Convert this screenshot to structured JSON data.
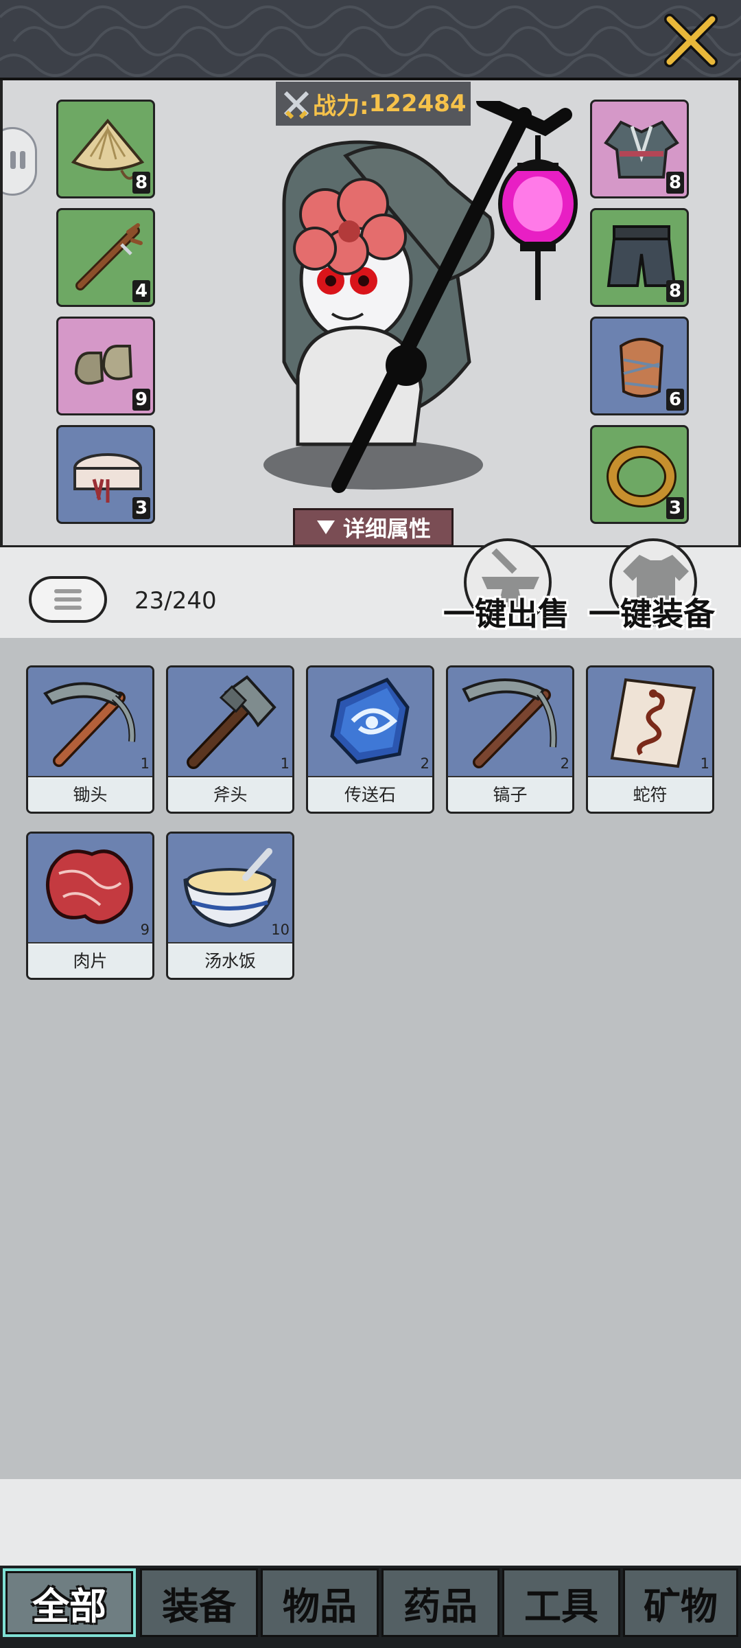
{
  "header": {
    "close_icon": "crossed-swords-close-icon"
  },
  "character": {
    "power_label": "战力:",
    "power_value": "122484",
    "detail_button": "详细属性",
    "left_slots": [
      {
        "name": "bamboo-hat",
        "level": "8",
        "color": "green"
      },
      {
        "name": "staff",
        "level": "4",
        "color": "green"
      },
      {
        "name": "boots",
        "level": "9",
        "color": "pink"
      },
      {
        "name": "belt",
        "level": "3",
        "color": "blue"
      }
    ],
    "right_slots": [
      {
        "name": "robe",
        "level": "8",
        "color": "pink"
      },
      {
        "name": "pants",
        "level": "8",
        "color": "green"
      },
      {
        "name": "bracer",
        "level": "6",
        "color": "blue"
      },
      {
        "name": "ring",
        "level": "3",
        "color": "green"
      }
    ]
  },
  "toolbar": {
    "capacity": "23/240",
    "sell_all": "一键出售",
    "equip_all": "一键装备"
  },
  "inventory": [
    {
      "name": "锄头",
      "qty": "1",
      "icon": "hoe-icon"
    },
    {
      "name": "斧头",
      "qty": "1",
      "icon": "axe-icon"
    },
    {
      "name": "传送石",
      "qty": "2",
      "icon": "teleport-stone-icon"
    },
    {
      "name": "镐子",
      "qty": "2",
      "icon": "pickaxe-icon"
    },
    {
      "name": "蛇符",
      "qty": "1",
      "icon": "snake-talisman-icon"
    },
    {
      "name": "肉片",
      "qty": "9",
      "icon": "meat-icon"
    },
    {
      "name": "汤水饭",
      "qty": "10",
      "icon": "soup-rice-icon"
    }
  ],
  "tabs": [
    "全部",
    "装备",
    "物品",
    "药品",
    "工具",
    "矿物"
  ],
  "active_tab": "全部"
}
